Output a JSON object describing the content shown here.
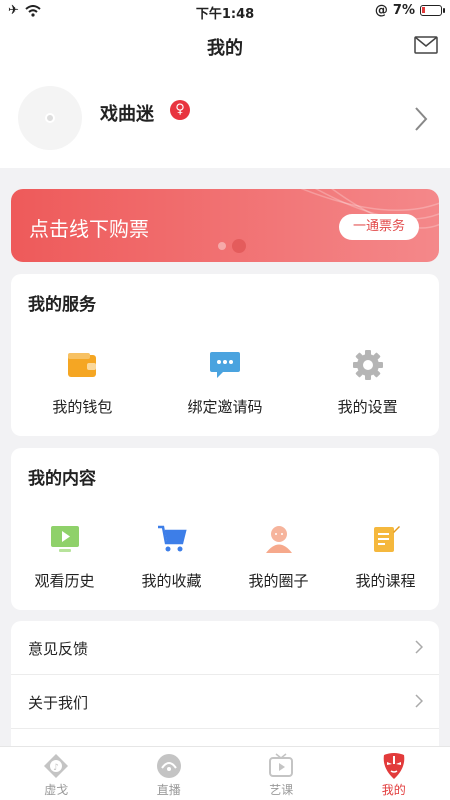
{
  "status": {
    "time": "下午1:48",
    "battery": "7%"
  },
  "nav": {
    "title": "我的",
    "mail_icon": "mail-icon"
  },
  "profile": {
    "name": "戏曲迷",
    "gender_symbol": "♀"
  },
  "banner": {
    "text": "点击线下购票",
    "button": "一通票务"
  },
  "services": {
    "title": "我的服务",
    "items": [
      {
        "label": "我的钱包",
        "icon": "wallet-icon",
        "color": "#f5a623"
      },
      {
        "label": "绑定邀请码",
        "icon": "message-icon",
        "color": "#4aa3df"
      },
      {
        "label": "我的设置",
        "icon": "gear-icon",
        "color": "#b0b0b0"
      }
    ]
  },
  "content": {
    "title": "我的内容",
    "items": [
      {
        "label": "观看历史",
        "icon": "play-screen-icon",
        "color": "#8fd16a"
      },
      {
        "label": "我的收藏",
        "icon": "cart-icon",
        "color": "#3d7ee8"
      },
      {
        "label": "我的圈子",
        "icon": "person-icon",
        "color": "#f6a98c"
      },
      {
        "label": "我的课程",
        "icon": "notebook-icon",
        "color": "#f5b83d"
      }
    ]
  },
  "list": [
    {
      "label": "意见反馈"
    },
    {
      "label": "关于我们"
    }
  ],
  "tabs": [
    {
      "label": "虚戈",
      "icon": "opera-icon"
    },
    {
      "label": "直播",
      "icon": "live-icon"
    },
    {
      "label": "艺课",
      "icon": "tv-icon"
    },
    {
      "label": "我的",
      "icon": "mask-icon",
      "active": true
    }
  ]
}
